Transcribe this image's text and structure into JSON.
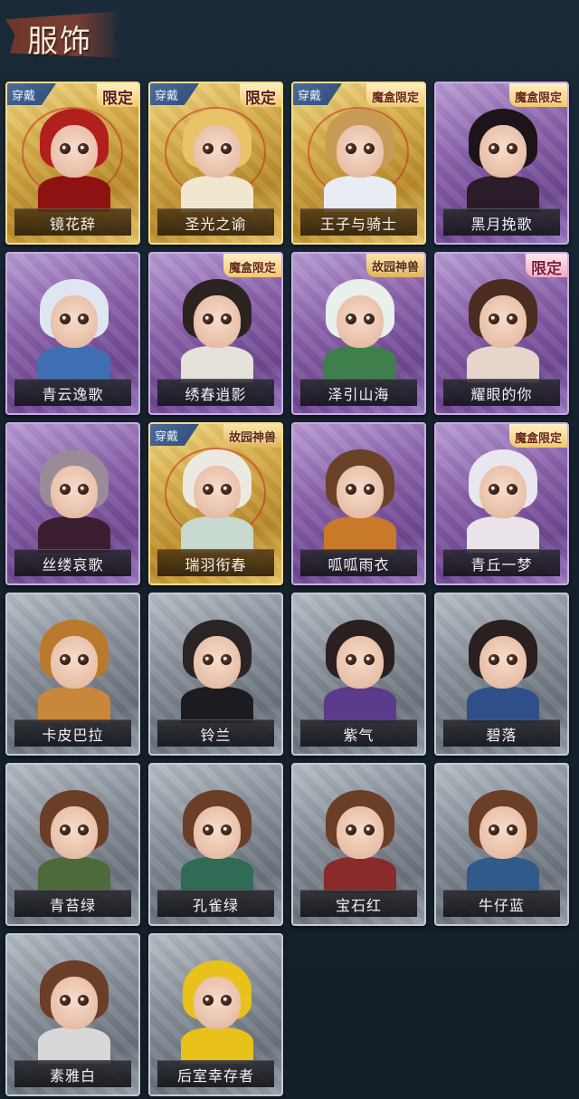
{
  "header": {
    "title": "服饰"
  },
  "badges": {
    "wear": "穿戴"
  },
  "cards": [
    {
      "name": "镜花辞",
      "frame": "gold",
      "worn": true,
      "tag": "限定",
      "tag_type": "limit",
      "hair": "#b21f1f",
      "body": "#8f1212"
    },
    {
      "name": "圣光之谕",
      "frame": "gold",
      "worn": true,
      "tag": "限定",
      "tag_type": "limit",
      "hair": "#e8c36a",
      "body": "#f1e6cf"
    },
    {
      "name": "王子与骑士",
      "frame": "gold",
      "worn": true,
      "tag": "魔盒限定",
      "tag_type": "box",
      "hair": "#c79a55",
      "body": "#e9ecf2"
    },
    {
      "name": "黑月挽歌",
      "frame": "purple",
      "worn": false,
      "tag": "魔盒限定",
      "tag_type": "box",
      "hair": "#1c1418",
      "body": "#2a1c28"
    },
    {
      "name": "青云逸歌",
      "frame": "purple",
      "worn": false,
      "tag": "",
      "tag_type": "",
      "hair": "#dfe6f2",
      "body": "#3f6fb3"
    },
    {
      "name": "绣春逍影",
      "frame": "purple",
      "worn": false,
      "tag": "魔盒限定",
      "tag_type": "box",
      "hair": "#2a2320",
      "body": "#e6e2da"
    },
    {
      "name": "泽引山海",
      "frame": "purple",
      "worn": false,
      "tag": "故园神兽",
      "tag_type": "beast",
      "hair": "#e9efea",
      "body": "#3f7f4b"
    },
    {
      "name": "耀眼的你",
      "frame": "purple",
      "worn": false,
      "tag": "限定",
      "tag_type": "limit-pink",
      "hair": "#4a2c20",
      "body": "#e6d6cc"
    },
    {
      "name": "丝缕哀歌",
      "frame": "purple",
      "worn": false,
      "tag": "",
      "tag_type": "",
      "hair": "#9a8b98",
      "body": "#3a1e30"
    },
    {
      "name": "瑞羽衔春",
      "frame": "gold",
      "worn": true,
      "tag": "故园神兽",
      "tag_type": "beast",
      "hair": "#ece9e2",
      "body": "#c8d9cf"
    },
    {
      "name": "呱呱雨衣",
      "frame": "purple",
      "worn": false,
      "tag": "",
      "tag_type": "",
      "hair": "#6a4228",
      "body": "#c87a2a"
    },
    {
      "name": "青丘一梦",
      "frame": "purple",
      "worn": false,
      "tag": "魔盒限定",
      "tag_type": "box",
      "hair": "#e8e6ef",
      "body": "#ebe3ea"
    },
    {
      "name": "卡皮巴拉",
      "frame": "gray",
      "worn": false,
      "tag": "",
      "tag_type": "",
      "hair": "#b97a2e",
      "body": "#c8873a"
    },
    {
      "name": "铃兰",
      "frame": "gray",
      "worn": false,
      "tag": "",
      "tag_type": "",
      "hair": "#2a2424",
      "body": "#1c1c20"
    },
    {
      "name": "紫气",
      "frame": "gray",
      "worn": false,
      "tag": "",
      "tag_type": "",
      "hair": "#2a2020",
      "body": "#5a3a8a"
    },
    {
      "name": "碧落",
      "frame": "gray",
      "worn": false,
      "tag": "",
      "tag_type": "",
      "hair": "#2a2020",
      "body": "#2f4f8a"
    },
    {
      "name": "青苔绿",
      "frame": "gray",
      "worn": false,
      "tag": "",
      "tag_type": "",
      "hair": "#6b3e28",
      "body": "#4d6b3a"
    },
    {
      "name": "孔雀绿",
      "frame": "gray",
      "worn": false,
      "tag": "",
      "tag_type": "",
      "hair": "#6b3e28",
      "body": "#2f6b55"
    },
    {
      "name": "宝石红",
      "frame": "gray",
      "worn": false,
      "tag": "",
      "tag_type": "",
      "hair": "#6b3e28",
      "body": "#8a2a2a"
    },
    {
      "name": "牛仔蓝",
      "frame": "gray",
      "worn": false,
      "tag": "",
      "tag_type": "",
      "hair": "#6b3e28",
      "body": "#2f5a8a"
    },
    {
      "name": "素雅白",
      "frame": "gray",
      "worn": false,
      "tag": "",
      "tag_type": "",
      "hair": "#6b3e28",
      "body": "#d8d8d8"
    },
    {
      "name": "后室幸存者",
      "frame": "gray",
      "worn": false,
      "tag": "",
      "tag_type": "",
      "hair": "#e8c21a",
      "body": "#e8c21a"
    }
  ]
}
